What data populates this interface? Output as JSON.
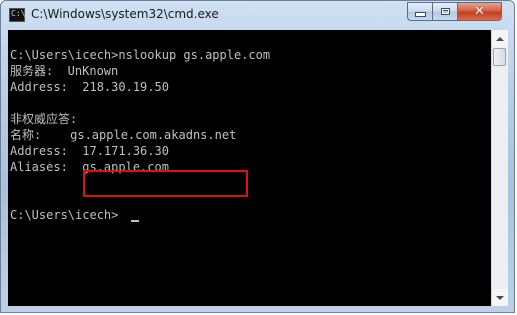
{
  "window": {
    "title": "C:\\Windows\\system32\\cmd.exe",
    "icon": "console-icon",
    "icon_text": "C:\\",
    "close_glyph": "✕"
  },
  "console": {
    "lines": [
      "",
      "C:\\Users\\icech>nslookup gs.apple.com",
      "服务器:  UnKnown",
      "Address:  218.30.19.50",
      "",
      "非权威应答:",
      "名称:    gs.apple.com.akadns.net",
      "Address:  17.171.36.30",
      "Aliases:  gs.apple.com",
      "",
      "",
      "C:\\Users\\icech>"
    ]
  },
  "colors": {
    "console_background": "#000000",
    "console_text": "#c0c0c0",
    "highlight_box": "#e01010"
  }
}
